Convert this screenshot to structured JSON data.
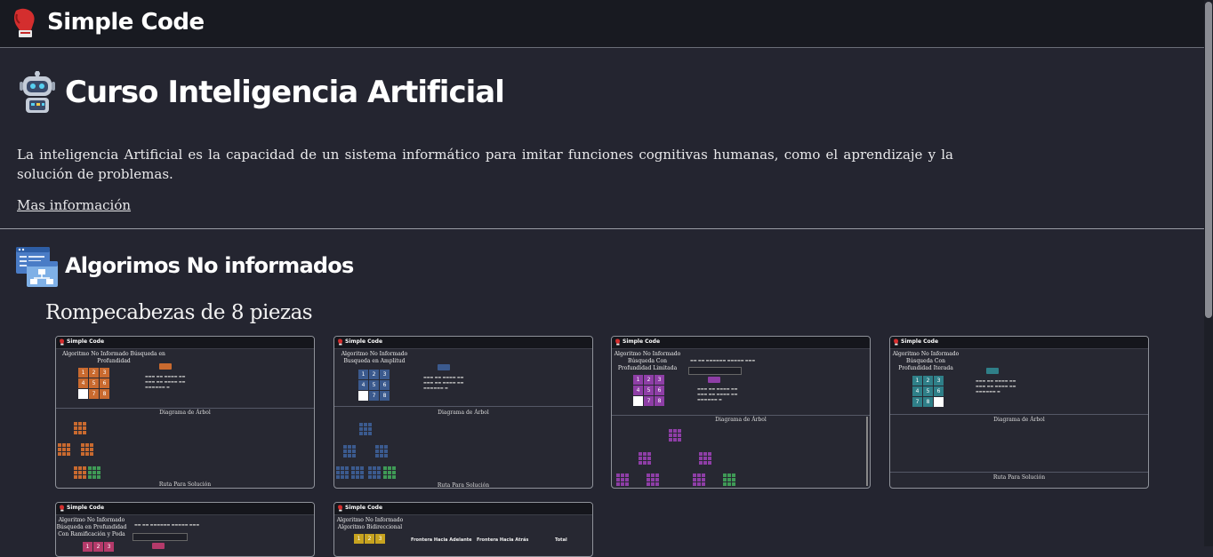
{
  "header": {
    "brand": "Simple Code",
    "logo_icon": "boxing-glove-icon"
  },
  "course": {
    "icon": "robot-icon",
    "title": "Curso Inteligencia Artificial",
    "description": "La inteligencia Artificial es la capacidad de un sistema informático para imitar funciones cognitivas humanas, como el aprendizaje y la solución de problemas.",
    "more_link": "Mas información"
  },
  "section": {
    "icon": "flowchart-window-icon",
    "title": "Algorimos No informados",
    "subsection": "Rompecabezas de 8 piezas"
  },
  "cards": [
    {
      "brand": "Simple Code",
      "title": "Algoritmo No Informado Búsqueda en Profundidad",
      "color": "#c96a2f",
      "tiles": [
        "1",
        "2",
        "3",
        "4",
        "5",
        "6",
        "",
        "7",
        "8"
      ],
      "caption": "Diagrama de Árbol",
      "footer": "Ruta Para Solución"
    },
    {
      "brand": "Simple Code",
      "title": "Algoritmo No Informado Busqueda en Amplitud",
      "color": "#3b5a8e",
      "tiles": [
        "1",
        "2",
        "3",
        "4",
        "5",
        "6",
        "",
        "7",
        "8"
      ],
      "caption": "Diagrama de Árbol",
      "footer": "Ruta Para Solución"
    },
    {
      "brand": "Simple Code",
      "title": "Algoritmo No Informado Búsqueda Con Profundidad Limitada",
      "color": "#8e3ea6",
      "tiles": [
        "1",
        "2",
        "3",
        "4",
        "5",
        "6",
        "",
        "7",
        "8"
      ],
      "caption": "Diagrama de Árbol",
      "footer": ""
    },
    {
      "brand": "Simple Code",
      "title": "Algoritmo No Informado Búsqueda Con Profundidad Iterada",
      "color": "#2f7f88",
      "tiles": [
        "1",
        "2",
        "3",
        "4",
        "5",
        "6",
        "7",
        "8",
        ""
      ],
      "caption": "Diagrama de Árbol",
      "footer": "Ruta Para Solución"
    },
    {
      "brand": "Simple Code",
      "title": "Algoritmo No Informado Búsqueda en Profundidad Con Ramificación y Poda",
      "color": "#b43a6a",
      "tiles": [
        "1",
        "2",
        "3"
      ],
      "caption": "",
      "footer": ""
    },
    {
      "brand": "Simple Code",
      "title": "Algoritmo No Informado Algoritmo Bidireccional",
      "color": "#c7a31f",
      "tiles": [
        "1",
        "2",
        "3"
      ],
      "caption": "",
      "footer": "",
      "columns": [
        "Frontera Hacia Adelante",
        "Frontera Hacia Atrás",
        "Total"
      ]
    }
  ],
  "colors": {
    "background": "#242530",
    "topbar": "#181a21",
    "tree_goal": "#3f9a56"
  }
}
